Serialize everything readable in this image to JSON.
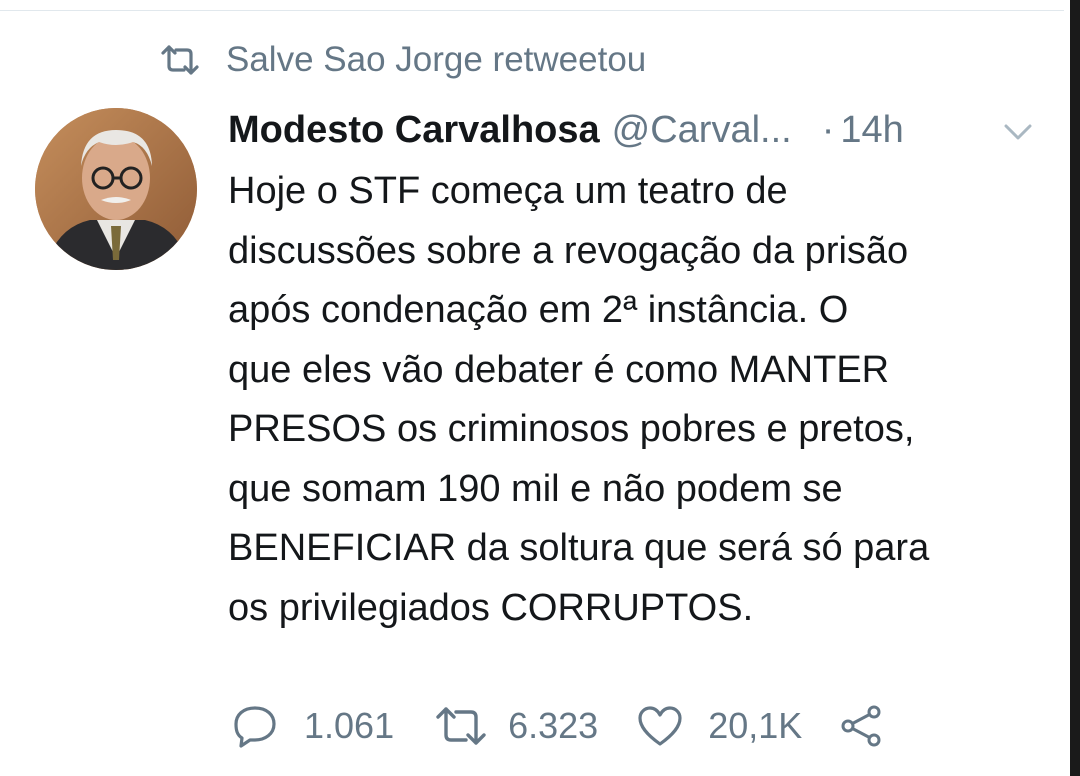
{
  "retweet_context": {
    "icon": "retweet-icon",
    "text": "Salve Sao Jorge retweetou"
  },
  "tweet": {
    "author": {
      "display_name": "Modesto Carvalhosa",
      "handle": "@Carval...",
      "avatar": "profile-photo"
    },
    "separator": "·",
    "time": "14h",
    "menu_icon": "chevron-down-icon",
    "text_lines": [
      "Hoje o STF começa um teatro de",
      "discussões sobre a revogação da prisão",
      "após condenação em 2ª instância. O",
      "que eles vão debater é como MANTER",
      "PRESOS os criminosos pobres e pretos,",
      "que somam 190 mil e não podem se",
      "BENEFICIAR da soltura que será só para",
      "os privilegiados CORRUPTOS."
    ],
    "actions": {
      "replies": "1.061",
      "retweets": "6.323",
      "likes": "20,1K"
    }
  },
  "colors": {
    "text": "#14171a",
    "secondary": "#657786",
    "divider": "#e1e8ed"
  }
}
